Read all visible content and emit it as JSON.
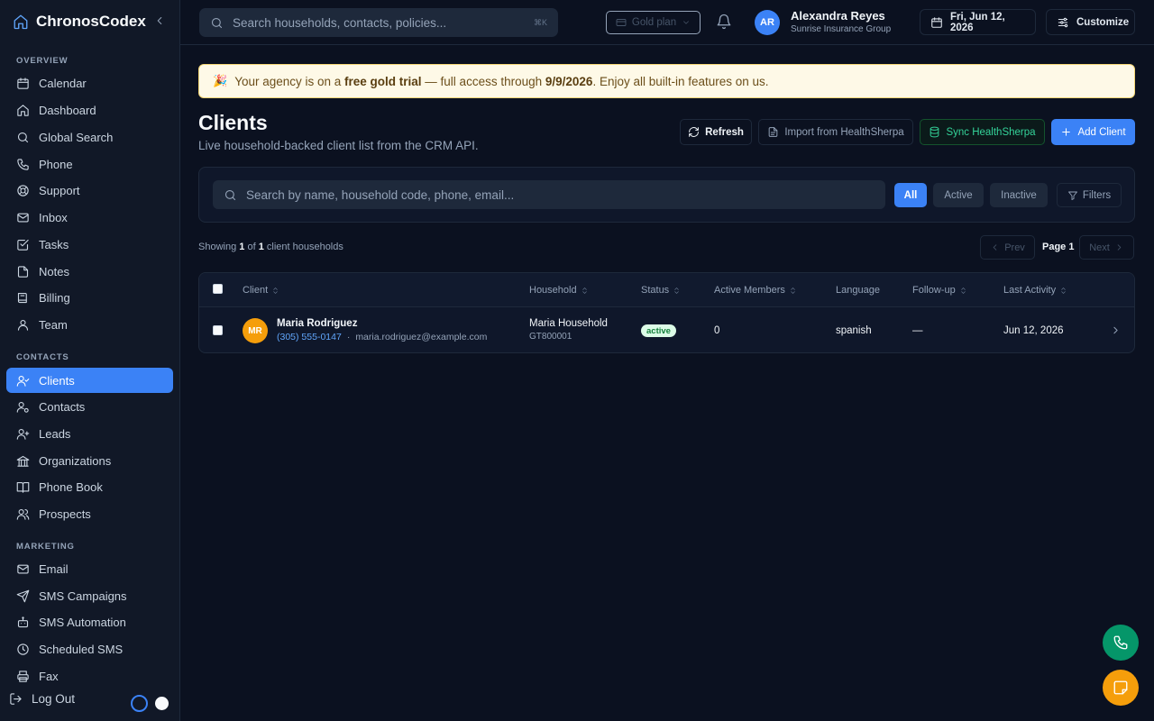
{
  "app": {
    "name": "ChronosCodex"
  },
  "sidebar": {
    "sections": [
      {
        "label": "OVERVIEW",
        "items": [
          {
            "label": "Calendar",
            "icon": "calendar-icon"
          },
          {
            "label": "Dashboard",
            "icon": "home-icon"
          },
          {
            "label": "Global Search",
            "icon": "search-icon"
          },
          {
            "label": "Phone",
            "icon": "phone-icon"
          },
          {
            "label": "Support",
            "icon": "lifebuoy-icon"
          },
          {
            "label": "Inbox",
            "icon": "mail-icon"
          },
          {
            "label": "Tasks",
            "icon": "check-square-icon"
          },
          {
            "label": "Notes",
            "icon": "file-icon"
          },
          {
            "label": "Billing",
            "icon": "book-icon"
          },
          {
            "label": "Team",
            "icon": "user-icon"
          }
        ]
      },
      {
        "label": "CONTACTS",
        "items": [
          {
            "label": "Clients",
            "icon": "user-check-icon",
            "active": true
          },
          {
            "label": "Contacts",
            "icon": "user-cog-icon"
          },
          {
            "label": "Leads",
            "icon": "user-plus-icon"
          },
          {
            "label": "Organizations",
            "icon": "building-icon"
          },
          {
            "label": "Phone Book",
            "icon": "book-open-icon"
          },
          {
            "label": "Prospects",
            "icon": "users-icon"
          }
        ]
      },
      {
        "label": "MARKETING",
        "items": [
          {
            "label": "Email",
            "icon": "mail-icon"
          },
          {
            "label": "SMS Campaigns",
            "icon": "send-icon"
          },
          {
            "label": "SMS Automation",
            "icon": "bot-icon"
          },
          {
            "label": "Scheduled SMS",
            "icon": "clock-icon"
          },
          {
            "label": "Fax",
            "icon": "printer-icon"
          }
        ]
      }
    ],
    "logout_label": "Log Out"
  },
  "topbar": {
    "search_placeholder": "Search households, contacts, policies...",
    "search_shortcut": "⌘K",
    "plan_label": "Gold plan",
    "user": {
      "initials": "AR",
      "name": "Alexandra Reyes",
      "org": "Sunrise Insurance Group"
    },
    "date_label": "Fri, Jun 12, 2026",
    "customize_label": "Customize"
  },
  "banner": {
    "emoji": "🎉",
    "text_1": "Your agency is on a ",
    "bold_1": "free gold trial",
    "text_2": " — full access through ",
    "bold_2": "9/9/2026",
    "text_3": ". Enjoy all built-in features on us."
  },
  "page": {
    "title": "Clients",
    "subtitle": "Live household-backed client list from the CRM API.",
    "buttons": {
      "refresh": "Refresh",
      "import": "Import from HealthSherpa",
      "sync": "Sync HealthSherpa",
      "add": "Add Client"
    }
  },
  "filters": {
    "search_placeholder": "Search by name, household code, phone, email...",
    "all": "All",
    "active": "Active",
    "inactive": "Inactive",
    "filters": "Filters"
  },
  "results": {
    "showing_prefix": "Showing ",
    "shown": "1",
    "of": " of ",
    "total": "1",
    "suffix": " client households",
    "prev": "Prev",
    "page": "Page 1",
    "next": "Next"
  },
  "table": {
    "columns": [
      "Client",
      "Household",
      "Status",
      "Active Members",
      "Language",
      "Follow-up",
      "Last Activity"
    ],
    "rows": [
      {
        "initials": "MR",
        "name": "Maria Rodriguez",
        "phone": "(305) 555-0147",
        "separator": "·",
        "email": "maria.rodriguez@example.com",
        "household": "Maria Household",
        "household_code": "GT800001",
        "status": "active",
        "active_members": "0",
        "language": "spanish",
        "follow_up": "—",
        "last_activity": "Jun 12, 2026"
      }
    ]
  },
  "colors": {
    "accent": "#3b82f6",
    "success": "#059669",
    "warning": "#f59e0b"
  }
}
